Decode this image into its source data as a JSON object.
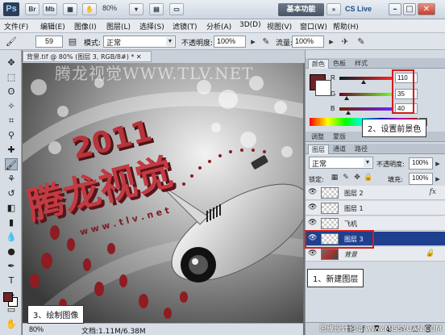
{
  "appbar": {
    "logo": "Ps",
    "buttons": [
      "Br",
      "Mb"
    ],
    "zoom": "80%",
    "workspace": "基本功能",
    "cs_live": "CS Live",
    "window_buttons": [
      "–",
      "□",
      "✕"
    ]
  },
  "menu": [
    "文件(F)",
    "编辑(E)",
    "图像(I)",
    "图层(L)",
    "选择(S)",
    "滤镜(T)",
    "分析(A)",
    "3D(D)",
    "视图(V)",
    "窗口(W)",
    "帮助(H)"
  ],
  "options": {
    "brush_size": "59",
    "mode_label": "模式:",
    "mode_value": "正常",
    "opacity_label": "不透明度:",
    "opacity_value": "100%",
    "flow_label": "流量:",
    "flow_value": "100%"
  },
  "document": {
    "tab_title": "背景.tif @ 80% (图层 3, RGB/8#) * ✕",
    "status_zoom": "80%",
    "status_doc": "文档:1.11M/6.38M"
  },
  "color_panel": {
    "tabs": [
      "颜色",
      "色板",
      "样式"
    ],
    "r_label": "R",
    "g_label": "G",
    "b_label": "B",
    "r_value": "110",
    "g_value": "35",
    "b_value": "40",
    "foreground_color": "#6e2328"
  },
  "layers_panel": {
    "tabs": [
      "图层",
      "通道",
      "路径"
    ],
    "blend_mode": "正常",
    "opacity_label": "不透明度:",
    "opacity_value": "100%",
    "lock_label": "锁定:",
    "fill_label": "填充:",
    "fill_value": "100%",
    "layers": [
      {
        "name": "图层 2",
        "extra": "fx",
        "selected": false
      },
      {
        "name": "图层 1",
        "extra": "",
        "selected": false
      },
      {
        "name": "飞机",
        "extra": "",
        "selected": false
      },
      {
        "name": "图层 3",
        "extra": "",
        "selected": true
      },
      {
        "name": "背景",
        "extra": "",
        "selected": false
      }
    ]
  },
  "callouts": {
    "set_fg": "2、设置前景色",
    "new_layer": "1、新建图层",
    "draw": "3、绘制图像"
  },
  "canvas": {
    "watermark_text": "腾龙视觉WWW.TLV.NET",
    "title_year": "2011",
    "title_brand": "腾龙视觉",
    "title_url": "w w w . t l v . n e t"
  },
  "site_watermark": "思缘设计论坛 www.MISSYUAN.COM",
  "colors": {
    "accent_red": "#d61b1b",
    "selected_layer": "#1f3f8f"
  }
}
